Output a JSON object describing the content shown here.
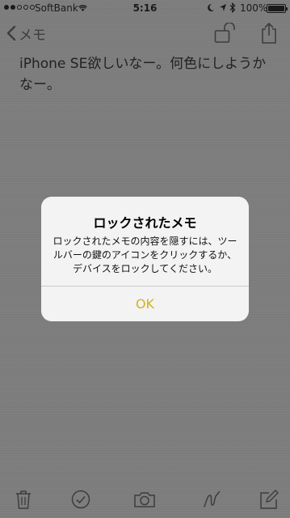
{
  "status_bar": {
    "carrier": "SoftBank",
    "time": "5:16",
    "battery": "100%"
  },
  "nav": {
    "back_label": "メモ"
  },
  "note": {
    "text": "iPhone SE欲しいなー。何色にしようかなー。"
  },
  "alert": {
    "title": "ロックされたメモ",
    "message": "ロックされたメモの内容を隠すには、ツールバーの鍵のアイコンをクリックするか、デバイスをロックしてください。",
    "ok_label": "OK"
  },
  "toolbar": {
    "icons": [
      "trash-icon",
      "checklist-icon",
      "camera-icon",
      "sketch-icon",
      "compose-icon"
    ]
  },
  "colors": {
    "accent": "#d4b21f",
    "dimmed_background": "#7e7e7e",
    "alert_background": "#f3f3f3"
  }
}
